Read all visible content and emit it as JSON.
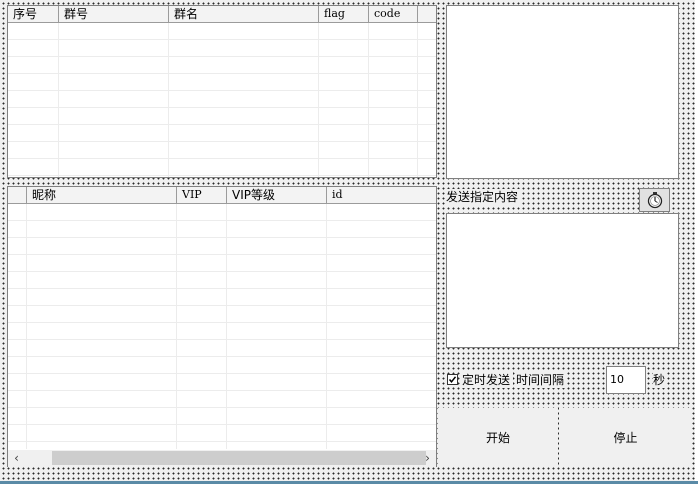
{
  "group_table": {
    "columns": [
      "序号",
      "群号",
      "群名",
      "flag",
      "code"
    ]
  },
  "member_table": {
    "columns": [
      "",
      "昵称",
      "VIP",
      "VIP等级",
      "id"
    ]
  },
  "send_section": {
    "label": "发送指定内容"
  },
  "timer": {
    "checkbox_label": "定时发送",
    "checked": true,
    "interval_label": "时间间隔",
    "interval_value": "10",
    "unit": "秒"
  },
  "buttons": {
    "start": "开始",
    "stop": "停止"
  },
  "icons": {
    "timer_button": "stopwatch-icon",
    "scroll_left": "chevron-left-icon",
    "scroll_right": "chevron-right-icon"
  }
}
